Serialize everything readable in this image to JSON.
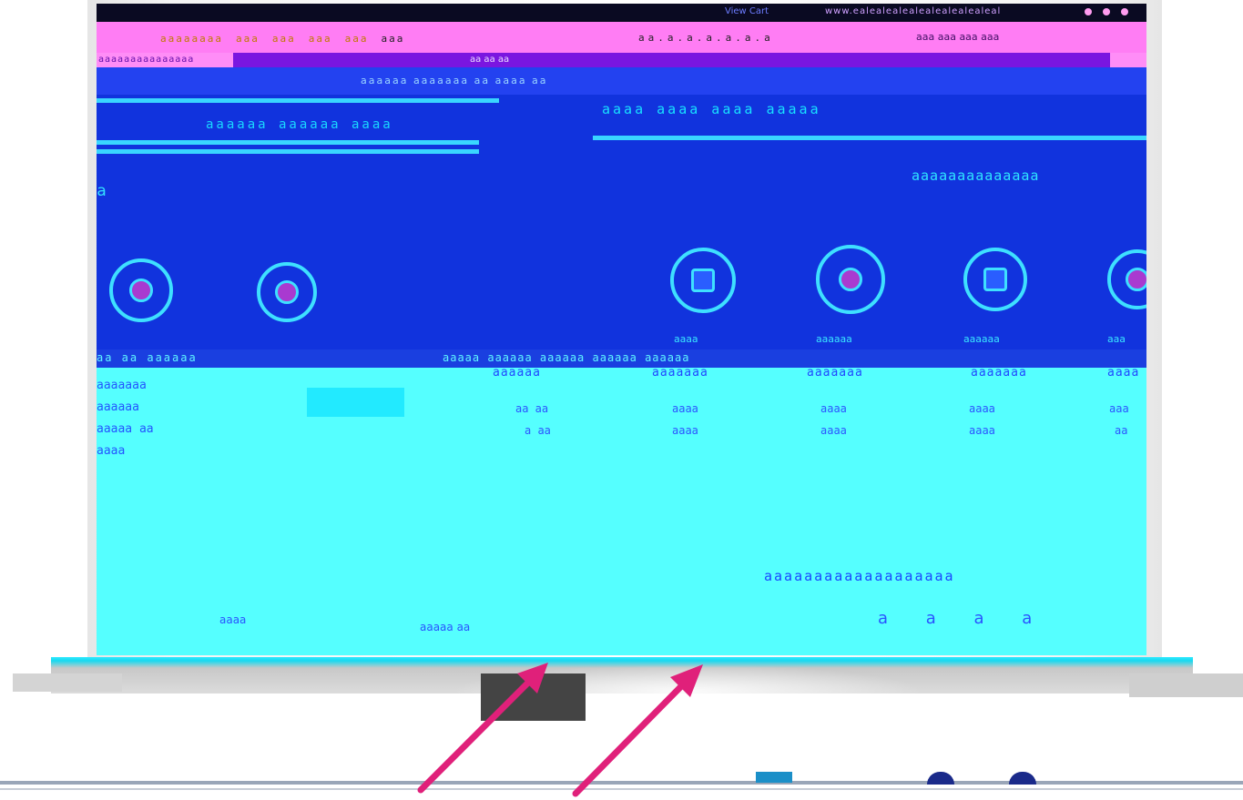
{
  "browser": {
    "title_text": "View Cart",
    "url_text": "www.ealealealealealealealealeal",
    "tabs": [
      "aaaaaaaa",
      "aaa",
      "aaa",
      "aaa",
      "aaa",
      "aaa"
    ],
    "address": "aa.a.a.a.a.a.a",
    "right_text": "aaa aaa aaa aaa"
  },
  "bookmarks": {
    "left": "aaaaaaaaaaaaaaa",
    "mid": "aa aa aa"
  },
  "nav": {
    "crumb": "aaaaaa aaaaaaa aa aaaa aa"
  },
  "header": {
    "left": "aaaaaa aaaaaa aaaa",
    "right": "aaaa aaaa aaaa aaaaa"
  },
  "page": {
    "id": "aaaaaaaaaaaaaa",
    "side_label": "aa"
  },
  "lower": {
    "band_left": "aa aa aaaaaa",
    "band_right": "aaaaa aaaaaa aaaaaa aaaaaa aaaaaa",
    "left_stats": [
      "aaaaaaa",
      "aaaaaa",
      "aaaaa aa",
      "aaaa"
    ],
    "columns": [
      {
        "head": "aaaaaa",
        "v1": "aa aa",
        "v2": "a aa"
      },
      {
        "head": "aaaaaaa",
        "v1": "aaaa",
        "v2": "aaaa"
      },
      {
        "head": "aaaaaaa",
        "v1": "aaaa",
        "v2": "aaaa"
      },
      {
        "head": "aaaaaaa",
        "v1": "aaaa",
        "v2": "aaaa"
      },
      {
        "head": "aaaa",
        "v1": "aaa",
        "v2": "aa"
      }
    ],
    "promo": "aaaaaaaaaaaaaaaaaaa",
    "promo_icons": "a a a a",
    "bottom_left": "aaaa",
    "bottom_mid": "aaaaa aa"
  },
  "icon_captions": [
    "aaaa",
    "aaaaaa",
    "aaaaaa",
    "aaa"
  ],
  "colors": {
    "screen": "#1133dd",
    "lower": "#55ffff",
    "tabstrip": "#ff7df4",
    "arrow": "#e0207a"
  }
}
